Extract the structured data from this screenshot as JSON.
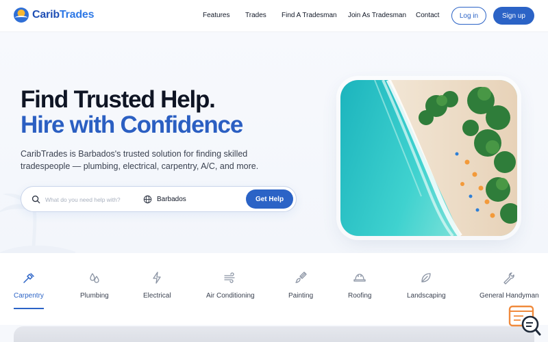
{
  "brand": {
    "name_part1": "Carib",
    "name_part2": "Trades"
  },
  "nav": {
    "links": [
      "Features",
      "Trades",
      "Find A Tradesman",
      "Join As Tradesman",
      "Contact"
    ],
    "login_label": "Log in",
    "signup_label": "Sign up"
  },
  "hero": {
    "headline_line1": "Find Trusted Help.",
    "headline_line2": "Hire with Confidence",
    "subtext": "CaribTrades is Barbados's trusted solution for finding skilled tradespeople — plumbing, electrical, carpentry, A/C, and more.",
    "search": {
      "placeholder": "What do you need help with?",
      "location": "Barbados",
      "button_label": "Get Help"
    }
  },
  "trades": [
    {
      "label": "Carpentry",
      "icon": "hammer-icon",
      "active": true
    },
    {
      "label": "Plumbing",
      "icon": "water-drops-icon",
      "active": false
    },
    {
      "label": "Electrical",
      "icon": "lightning-icon",
      "active": false
    },
    {
      "label": "Air Conditioning",
      "icon": "wind-icon",
      "active": false
    },
    {
      "label": "Painting",
      "icon": "paintbrush-icon",
      "active": false
    },
    {
      "label": "Roofing",
      "icon": "hard-hat-icon",
      "active": false
    },
    {
      "label": "Landscaping",
      "icon": "leaf-icon",
      "active": false
    },
    {
      "label": "General Handyman",
      "icon": "wrench-icon",
      "active": false
    }
  ],
  "colors": {
    "primary": "#2b63c6",
    "headline_dark": "#0f1524",
    "headline_blue": "#2b5fc2",
    "chat_accent": "#f08a3c"
  }
}
